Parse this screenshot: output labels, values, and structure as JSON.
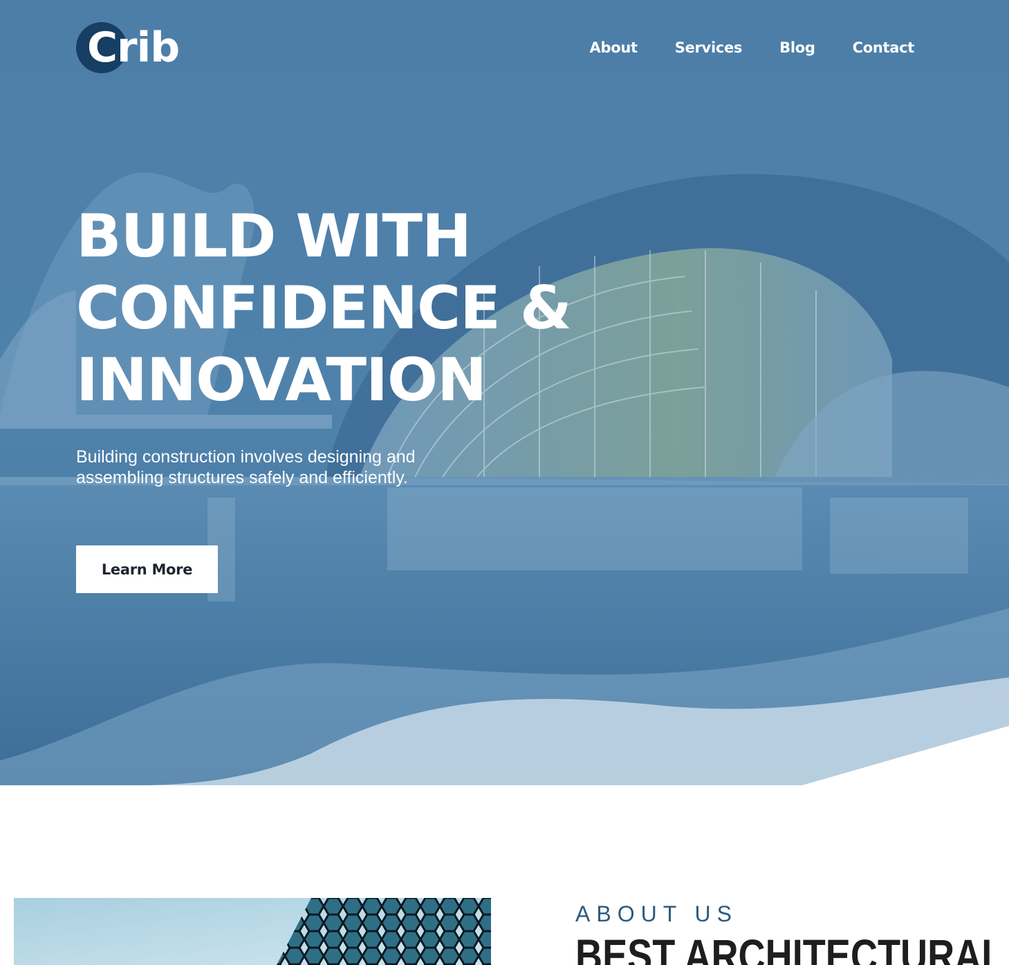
{
  "brand": {
    "name": "Crib"
  },
  "nav": {
    "items": [
      "About",
      "Services",
      "Blog",
      "Contact"
    ]
  },
  "hero": {
    "headline_lines": [
      "BUILD WITH",
      "CONFIDENCE &",
      "INNOVATION"
    ],
    "subtext": "Building construction involves designing and assembling structures safely and efficiently.",
    "cta_label": "Learn More"
  },
  "about": {
    "label": "ABOUT US",
    "title": "BEST ARCHITECTURAL"
  },
  "colors": {
    "hero_overlay": "#4a7aa3",
    "logo_circle": "#173e63",
    "accent": "#2c5b80",
    "heading_dark": "#1e1e1e"
  },
  "icons": {
    "logo": "c-circle-logo-icon"
  }
}
